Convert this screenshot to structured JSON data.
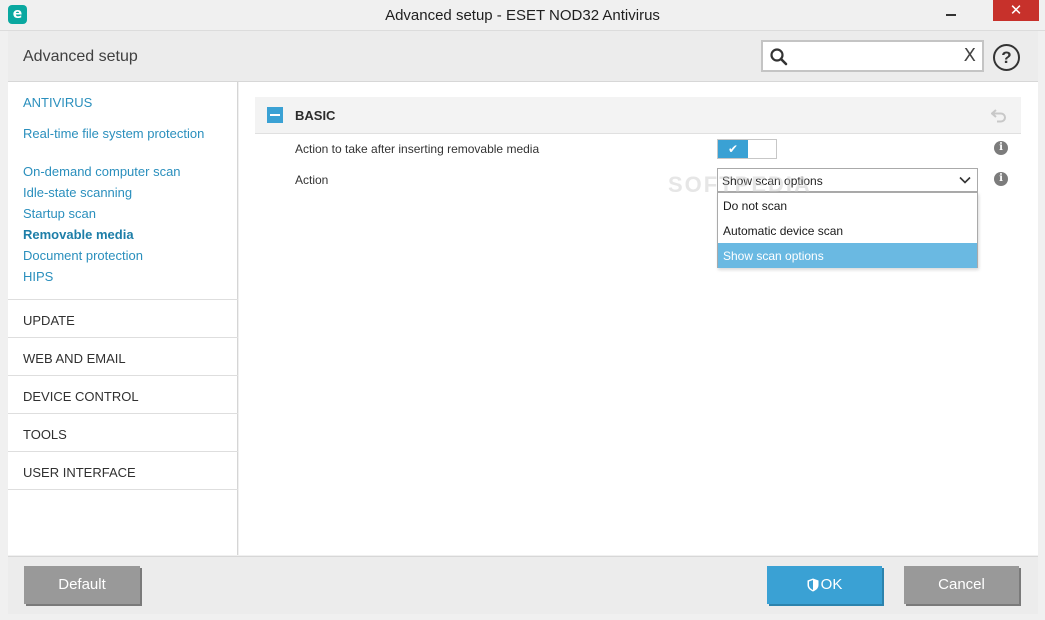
{
  "window": {
    "title": "Advanced setup - ESET NOD32 Antivirus",
    "logo_letter": "e",
    "close_glyph": "✕",
    "minimize_glyph": "—"
  },
  "header": {
    "title": "Advanced setup",
    "search_value": "",
    "clear_glyph": "X",
    "help_glyph": "?"
  },
  "sidebar": {
    "section_title": "ANTIVIRUS",
    "sub_items": [
      {
        "label": "Real-time file system protection",
        "active": false
      },
      {
        "label": "On-demand computer scan",
        "active": false
      },
      {
        "label": "Idle-state scanning",
        "active": false
      },
      {
        "label": "Startup scan",
        "active": false
      },
      {
        "label": "Removable media",
        "active": true
      },
      {
        "label": "Document protection",
        "active": false
      },
      {
        "label": "HIPS",
        "active": false
      }
    ],
    "categories": [
      "UPDATE",
      "WEB AND EMAIL",
      "DEVICE CONTROL",
      "TOOLS",
      "USER INTERFACE"
    ]
  },
  "content": {
    "section_title": "BASIC",
    "settings": [
      {
        "label": "Action to take after inserting removable media",
        "type": "toggle",
        "value": true
      },
      {
        "label": "Action",
        "type": "select",
        "value": "Show scan options"
      }
    ],
    "dropdown_options": [
      "Do not scan",
      "Automatic device scan",
      "Show scan options"
    ],
    "dropdown_selected": "Show scan options",
    "info_glyph": "i",
    "toggle_glyph": "✔",
    "watermark": "SOFTPEDIA"
  },
  "footer": {
    "default_label": "Default",
    "ok_label": "OK",
    "cancel_label": "Cancel"
  },
  "colors": {
    "accent": "#3aa1d4",
    "link": "#2a8fbd",
    "close_red": "#c7312b",
    "selected_option": "#6ab9e2"
  }
}
